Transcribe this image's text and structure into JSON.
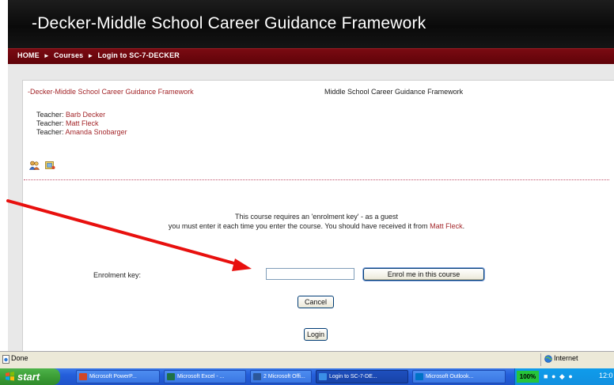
{
  "site": {
    "title": "-Decker-Middle School Career Guidance Framework"
  },
  "breadcrumb": {
    "home": "HOME",
    "courses": "Courses",
    "current": "Login to SC-7-DECKER"
  },
  "course": {
    "name": "-Decker-Middle School Career Guidance Framework",
    "summary": "Middle School Career Guidance Framework",
    "teachers": [
      {
        "role": "Teacher:",
        "name": "Barb Decker"
      },
      {
        "role": "Teacher:",
        "name": "Matt Fleck"
      },
      {
        "role": "Teacher:",
        "name": "Amanda Snobarger"
      }
    ],
    "icons": [
      "guest-access-icon",
      "enrolment-key-icon"
    ]
  },
  "enrolment": {
    "notice_line1": "This course requires an 'enrolment key' - as a guest",
    "notice_line2": "you must enter it each time you enter the course. You should have received it from",
    "notice_teacher": "Matt Fleck",
    "notice_end": ".",
    "key_label": "Enrolment key:",
    "key_value": "",
    "enrol_button": "Enrol me in this course",
    "cancel_button": "Cancel",
    "login_button": "Login"
  },
  "annotation": {
    "arrow_color": "#e8100e"
  },
  "statusbar": {
    "status": "Done",
    "zone": "Internet"
  },
  "taskbar": {
    "start": "start",
    "tasks": [
      {
        "label": "Microsoft PowerP...",
        "icon_color": "#d24726"
      },
      {
        "label": "Microsoft Excel - ...",
        "icon_color": "#1e7145"
      },
      {
        "label": "2 Microsoft Offi...",
        "icon_color": "#2b579a"
      },
      {
        "label": "Login to SC-7-DE...",
        "icon_color": "#3a8ee6"
      },
      {
        "label": "Microsoft Outlook...",
        "icon_color": "#0072c6"
      }
    ],
    "tray": {
      "zoom": "100%",
      "clock": "12:0"
    }
  },
  "colors": {
    "header_bg": "#111111",
    "navbar_bg": "#6d0810",
    "link": "#a3262a",
    "taskbar": "#245edb",
    "start": "#3c9e36"
  }
}
